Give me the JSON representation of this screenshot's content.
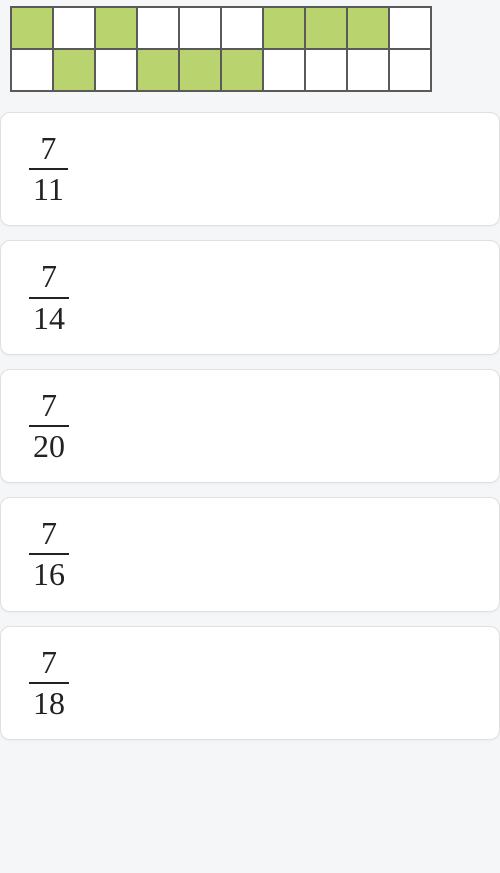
{
  "grid": {
    "rows": 2,
    "cols": 10,
    "cells": [
      [
        true,
        false,
        true,
        false,
        false,
        false,
        true,
        true,
        true,
        false
      ],
      [
        false,
        true,
        false,
        true,
        true,
        true,
        false,
        false,
        false,
        false
      ]
    ],
    "fill_color": "#b9d46f"
  },
  "options": [
    {
      "numerator": "7",
      "denominator": "11"
    },
    {
      "numerator": "7",
      "denominator": "14"
    },
    {
      "numerator": "7",
      "denominator": "20"
    },
    {
      "numerator": "7",
      "denominator": "16"
    },
    {
      "numerator": "7",
      "denominator": "18"
    }
  ]
}
